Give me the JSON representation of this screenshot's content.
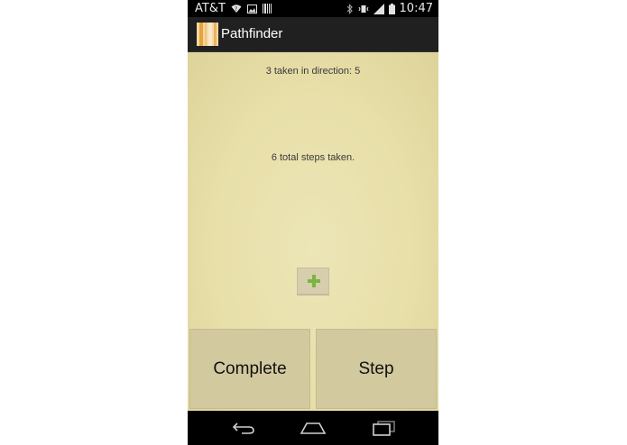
{
  "status_bar": {
    "carrier": "AT&T",
    "time": "10:47",
    "icons": [
      "wifi-question-icon",
      "image-notification-icon",
      "barcode-icon",
      "bluetooth-icon",
      "vibrate-icon",
      "signal-icon",
      "battery-icon"
    ]
  },
  "action_bar": {
    "title": "Pathfinder"
  },
  "main": {
    "direction_text": "3 taken in direction: 5",
    "total_text": "6 total steps taken.",
    "add_icon": "plus-icon"
  },
  "buttons": {
    "complete_label": "Complete",
    "step_label": "Step"
  },
  "nav_bar": {
    "icons": [
      "back-icon",
      "home-icon",
      "recents-icon"
    ]
  },
  "colors": {
    "content_bg": "#e8dfa9",
    "button_bg": "#d2c99f",
    "plus_green": "#7cb342"
  }
}
